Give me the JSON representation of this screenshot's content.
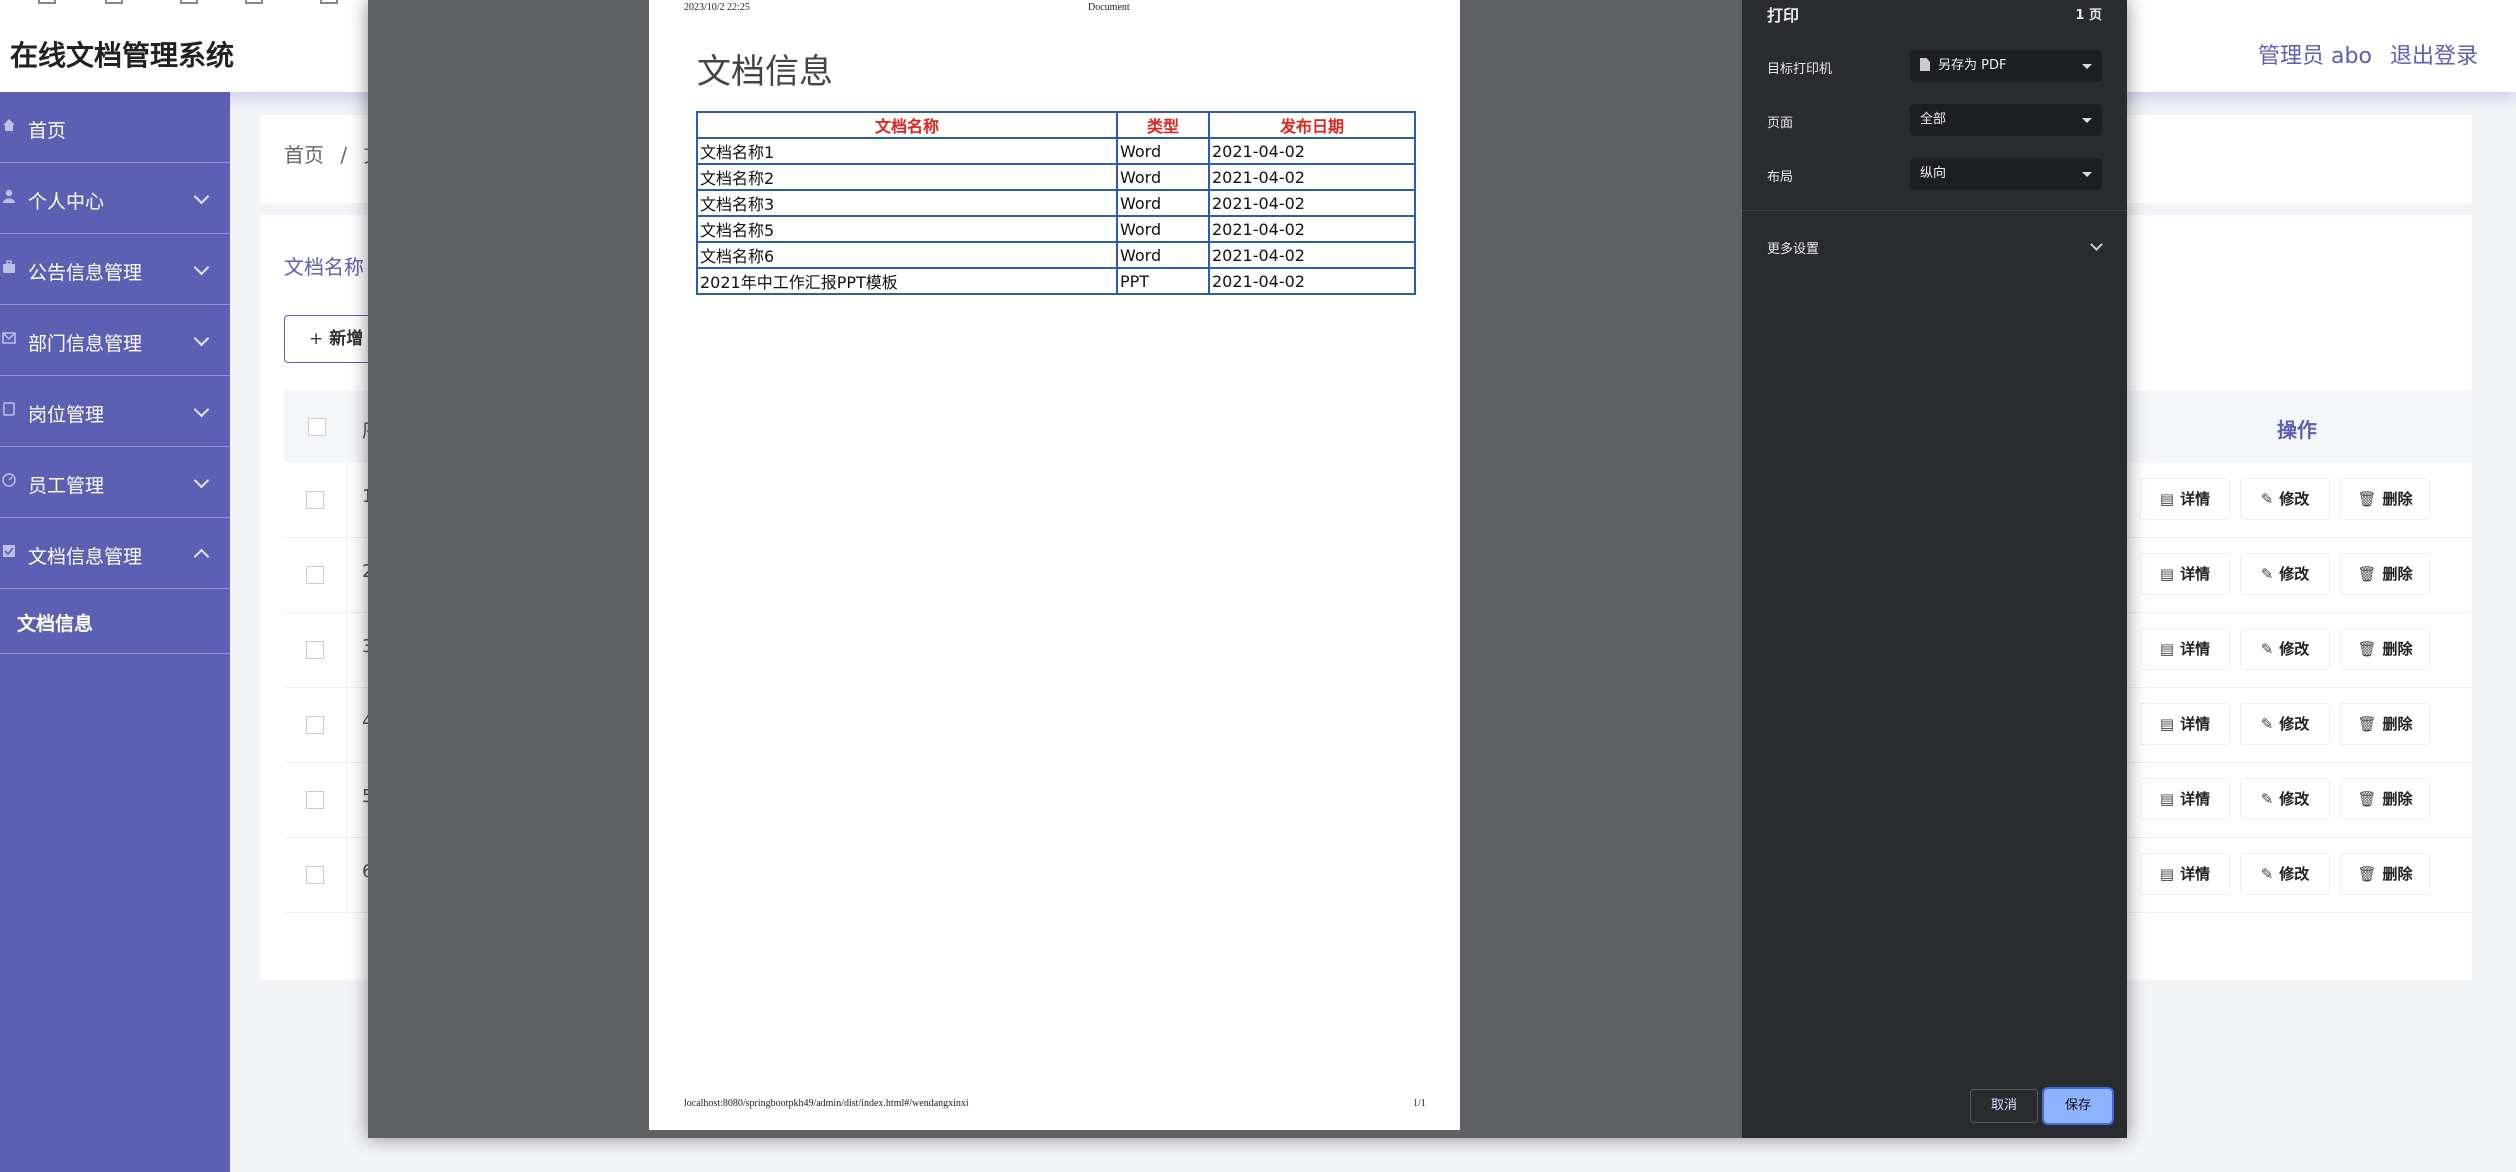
{
  "app": {
    "title": "在线文档管理系统",
    "user_label": "管理员 abo",
    "logout_label": "退出登录"
  },
  "sidebar": {
    "items": [
      {
        "label": "首页",
        "icon": "home-icon"
      },
      {
        "label": "个人中心",
        "icon": "user-icon"
      },
      {
        "label": "公告信息管理",
        "icon": "briefcase-icon"
      },
      {
        "label": "部门信息管理",
        "icon": "mail-icon"
      },
      {
        "label": "岗位管理",
        "icon": "clipboard-icon"
      },
      {
        "label": "员工管理",
        "icon": "gauge-icon"
      },
      {
        "label": "文档信息管理",
        "icon": "check-box-icon"
      }
    ],
    "sub_item": "文档信息"
  },
  "breadcrumb": {
    "home": "首页",
    "separator": "/",
    "current": "文"
  },
  "search": {
    "label": "文档名称"
  },
  "toolbar": {
    "add_label": "新增"
  },
  "table": {
    "header_partial": "序",
    "op_header": "操作",
    "rows": [
      "1",
      "2",
      "3",
      "4",
      "5",
      "6"
    ],
    "actions": {
      "detail": "详情",
      "edit": "修改",
      "delete": "删除"
    }
  },
  "print_preview": {
    "header_date": "2023/10/2 22:25",
    "header_title": "Document",
    "heading": "文档信息",
    "columns": [
      "文档名称",
      "类型",
      "发布日期"
    ],
    "rows": [
      [
        "文档名称1",
        "Word",
        "2021-04-02"
      ],
      [
        "文档名称2",
        "Word",
        "2021-04-02"
      ],
      [
        "文档名称3",
        "Word",
        "2021-04-02"
      ],
      [
        "文档名称5",
        "Word",
        "2021-04-02"
      ],
      [
        "文档名称6",
        "Word",
        "2021-04-02"
      ],
      [
        "2021年中工作汇报PPT模板",
        "PPT",
        "2021-04-02"
      ]
    ],
    "footer_url": "localhost:8080/springbootpkh49/admin/dist/index.html#/wendangxinxi",
    "footer_page": "1/1"
  },
  "print_dialog": {
    "title": "打印",
    "page_count": "1 页",
    "destination_label": "目标打印机",
    "destination_value": "另存为 PDF",
    "pages_label": "页面",
    "pages_value": "全部",
    "layout_label": "布局",
    "layout_value": "纵向",
    "more_settings": "更多设置",
    "cancel_label": "取消",
    "save_label": "保存"
  },
  "colors": {
    "accent": "#5d5fb3",
    "table_border": "#2b5fa8",
    "table_header_text": "#e0241f",
    "dialog_bg": "#2a2b2e",
    "save_button": "#8fb2ff"
  }
}
